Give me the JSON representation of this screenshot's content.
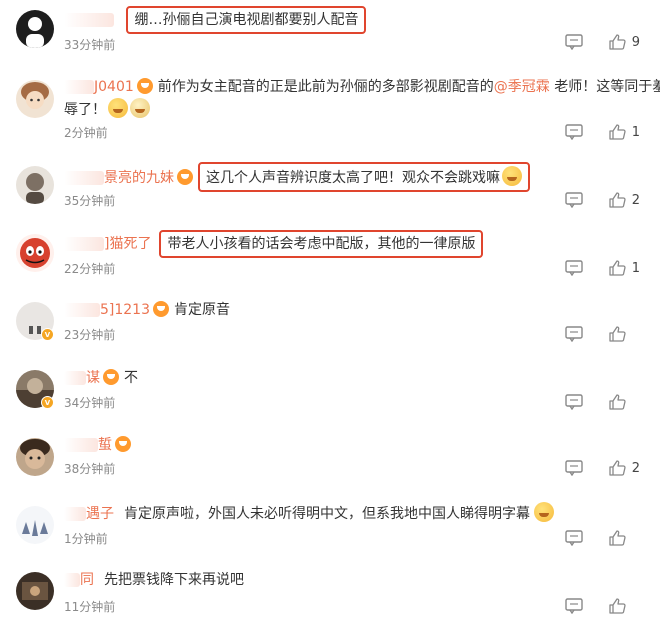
{
  "comments": [
    {
      "user": "",
      "text": "绷…孙俪自己演电视剧都要别人配音",
      "time": "33分钟前",
      "likes": "9",
      "highlight": true,
      "avatar_color": "#1e1e1e",
      "badge": false
    },
    {
      "user": "J0401",
      "text_pre": "前作为女主配音的正是此前为孙俪的多部影视剧配音的",
      "mention": "@季冠霖",
      "text_post": " 老师！这等同于羞",
      "text_line2": "辱了！",
      "time": "2分钟前",
      "likes": "1",
      "avatar_color": "#c8a889",
      "badge": false
    },
    {
      "user": "景亮的九妹",
      "text": "这几个人声音辨识度太高了吧！观众不会跳戏嘛",
      "time": "35分钟前",
      "likes": "2",
      "highlight": true,
      "avatar_color": "#9a8f86",
      "badge": false
    },
    {
      "user": "]猫死了",
      "text": "带老人小孩看的话会考虑中配版，其他的一律原版",
      "time": "22分钟前",
      "likes": "1",
      "highlight": true,
      "avatar_color": "#d7412e",
      "badge": false
    },
    {
      "user": "5]1213",
      "text": "肯定原音",
      "time": "23分钟前",
      "likes": "",
      "avatar_color": "#e9e6e3",
      "badge": true
    },
    {
      "user": "谋",
      "text": "不",
      "time": "34分钟前",
      "likes": "",
      "avatar_color": "#6b5a48",
      "badge": true
    },
    {
      "user": "蜇",
      "text": "",
      "time": "38分钟前",
      "likes": "2",
      "avatar_color": "#a08264",
      "badge": false
    },
    {
      "user": "遇子",
      "text": "肯定原声啦，外国人未必听得明中文，但系我地中国人睇得明字幕",
      "time": "1分钟前",
      "likes": "",
      "avatar_color": "#dfe3ea",
      "badge": false
    },
    {
      "user": "同",
      "text": "先把票钱降下来再说吧",
      "time": "11分钟前",
      "likes": "",
      "avatar_color": "#3b2f26",
      "badge": false
    }
  ],
  "icons": {
    "reply": "comment-icon",
    "like": "thumbs-up-icon",
    "user_badge": "member-badge-icon",
    "verified": "verified-badge-icon"
  }
}
